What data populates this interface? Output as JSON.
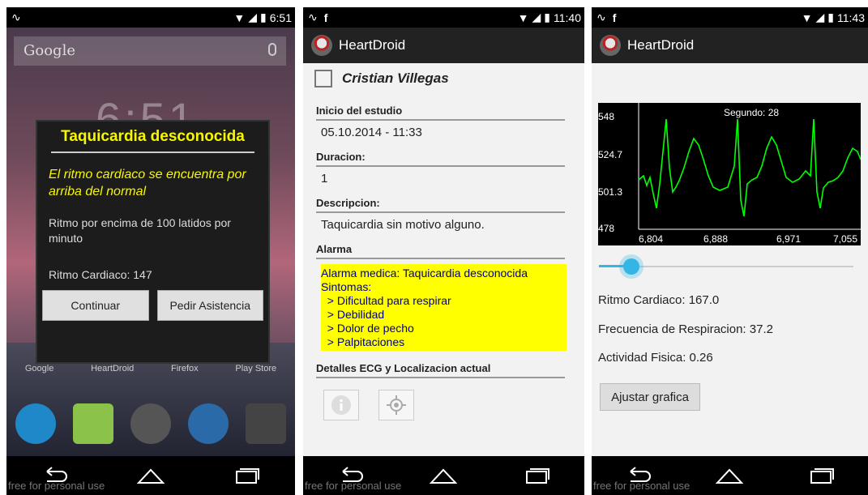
{
  "screen1": {
    "status": {
      "time": "6:51"
    },
    "search": {
      "placeholder": "Google"
    },
    "clock": "6:51",
    "dialog": {
      "title": "Taquicardia desconocida",
      "message": "El ritmo cardiaco se encuentra por arriba del normal",
      "detail": "Ritmo por encima de 100 latidos por minuto",
      "rate": "Ritmo Cardiaco: 147",
      "btn_continue": "Continuar",
      "btn_help": "Pedir Asistencia"
    },
    "app_labels": [
      "Google",
      "HeartDroid",
      "Firefox",
      "Play Store"
    ],
    "watermark": "free for personal use"
  },
  "screen2": {
    "status": {
      "time": "11:40"
    },
    "app_title": "HeartDroid",
    "user_name": "Cristian Villegas",
    "inicio_label": "Inicio del estudio",
    "inicio_value": "05.10.2014 - 11:33",
    "duracion_label": "Duracion:",
    "duracion_value": "1",
    "descripcion_label": "Descripcion:",
    "descripcion_value": "Taquicardia sin motivo alguno.",
    "alarma_label": "Alarma",
    "alarma_lines": [
      "Alarma medica: Taquicardia desconocida",
      "Sintomas:",
      "  > Dificultad para respirar",
      "  > Debilidad",
      "  > Dolor de pecho",
      "  > Palpitaciones"
    ],
    "detalles_label": "Detalles ECG y Localizacion actual",
    "watermark": "free for personal use"
  },
  "screen3": {
    "status": {
      "time": "11:43"
    },
    "app_title": "HeartDroid",
    "ecg": {
      "title": "Segundo: 28",
      "y_ticks": [
        "548",
        "524.7",
        "501.3",
        "478"
      ],
      "x_ticks": [
        "6,804",
        "6,888",
        "6,971",
        "7,055"
      ],
      "line_color": "#00ff00"
    },
    "slider_value": 0.06,
    "ritmo": "Ritmo Cardiaco: 167.0",
    "respiracion": "Frecuencia de Respiracion: 37.2",
    "actividad": "Actividad Fisica: 0.26",
    "ajustar": "Ajustar grafica",
    "watermark": "free for personal use"
  }
}
